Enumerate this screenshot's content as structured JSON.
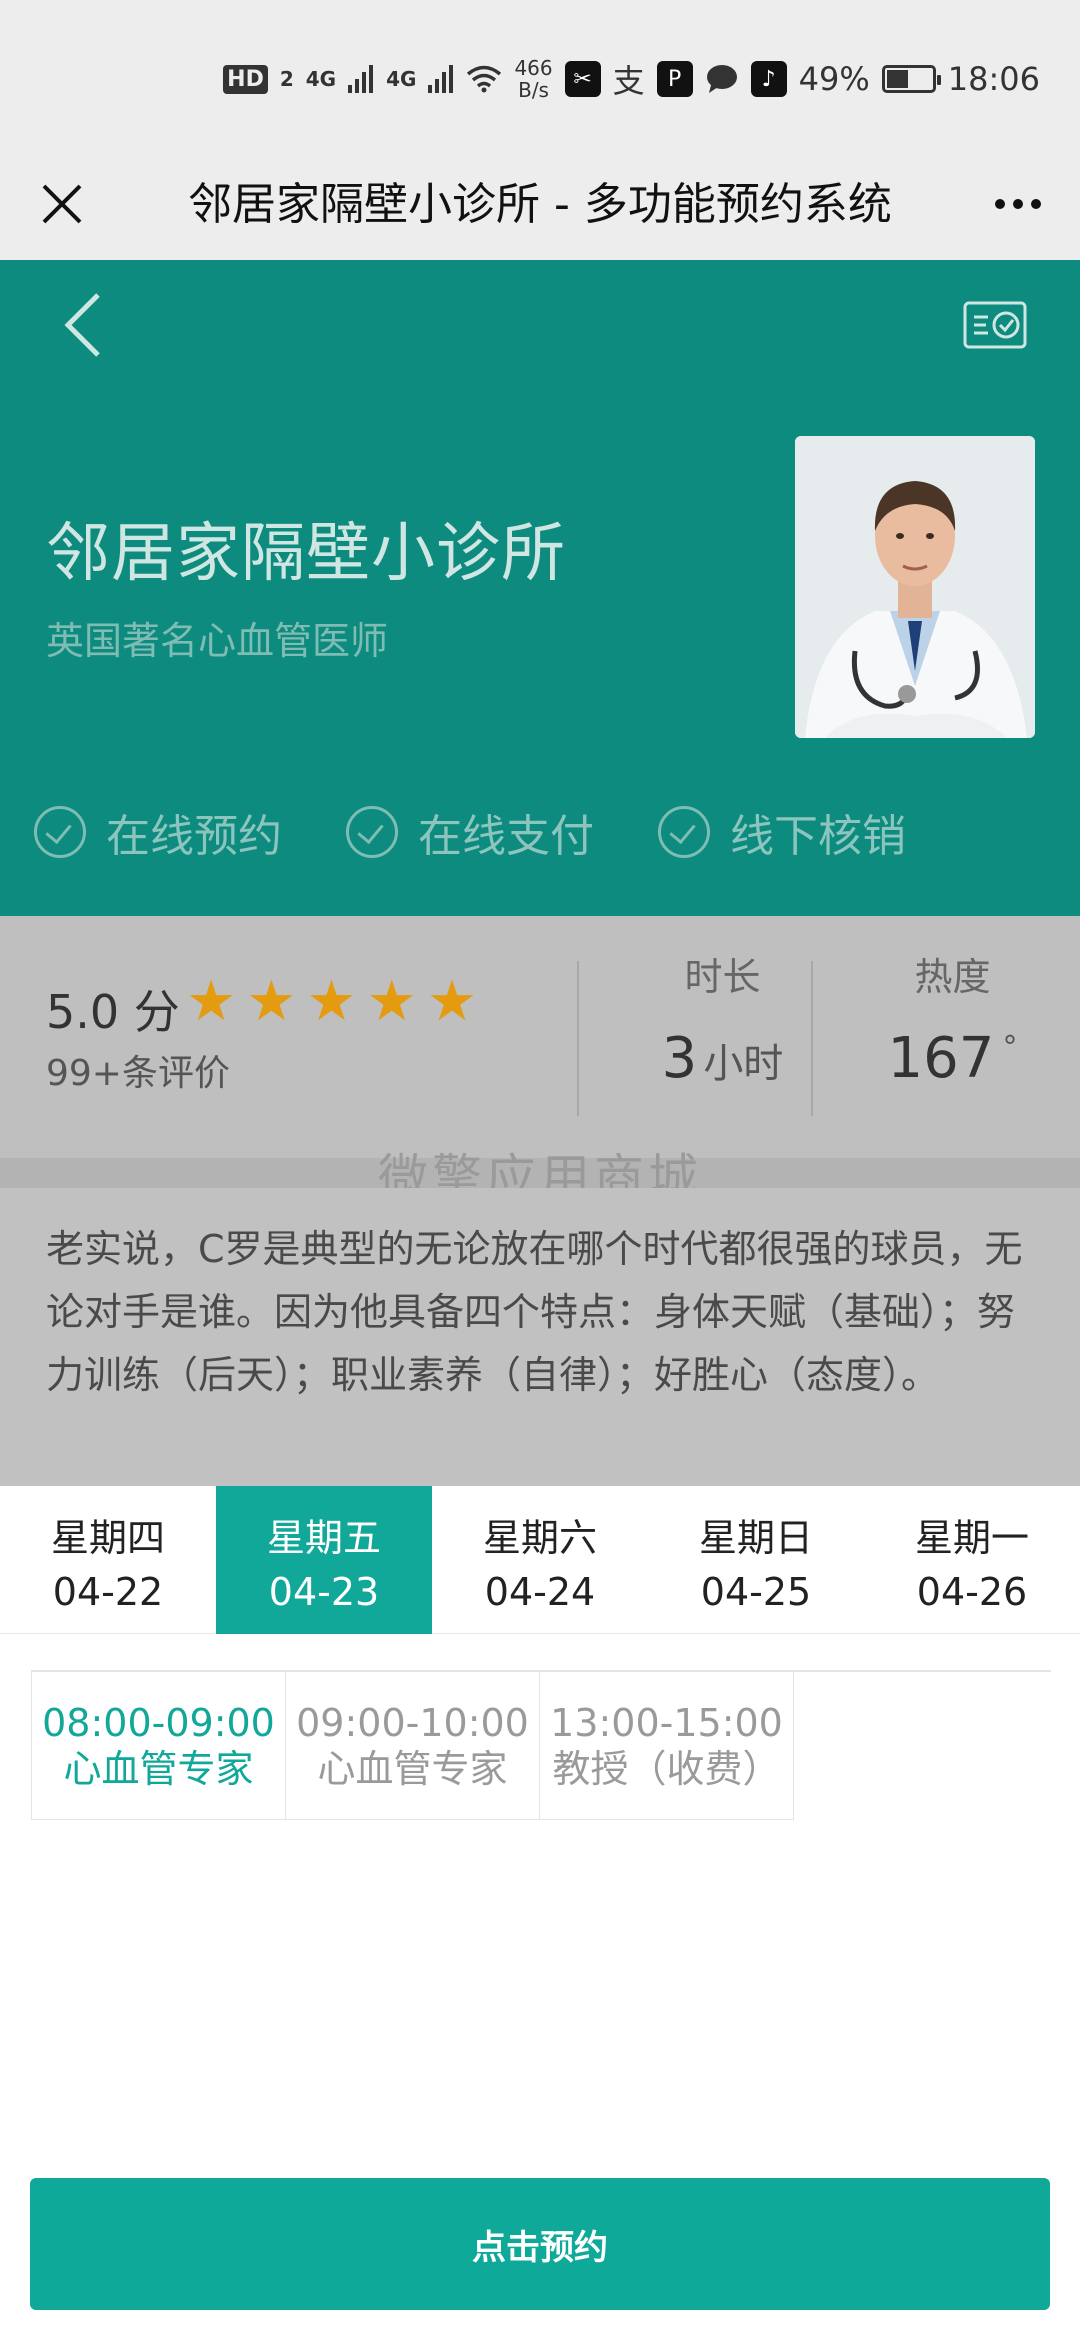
{
  "status_bar": {
    "hd_badge": "HD",
    "sim": "2",
    "signal1": "4G",
    "signal2": "4G",
    "speed_value": "466",
    "speed_unit": "B/s",
    "battery": "49%",
    "battery_level": 0.49,
    "time": "18:06"
  },
  "titlebar": {
    "title": "邻居家隔壁小诊所 - 多功能预约系统"
  },
  "header": {
    "clinic_name": "邻居家隔壁小诊所",
    "subtitle": "英国著名心血管医师",
    "features": [
      "在线预约",
      "在线支付",
      "线下核销"
    ],
    "accent_color": "#0e8b7f"
  },
  "stats": {
    "rating_score": "5.0 分",
    "rating_stars": 5,
    "rating_count": "99+条评价",
    "duration_label": "时长",
    "duration_value": "3",
    "duration_unit": "小时",
    "heat_label": "热度",
    "heat_value": "167",
    "heat_unit": "°"
  },
  "watermark": "微擎应用商城",
  "description": "老实说，C罗是典型的无论放在哪个时代都很强的球员，无论对手是谁。因为他具备四个特点：身体天赋（基础）；努力训练（后天）；职业素养（自律）；好胜心（态度）。",
  "dates": [
    {
      "day": "星期四",
      "date": "04-22"
    },
    {
      "day": "星期五",
      "date": "04-23",
      "active": true
    },
    {
      "day": "星期六",
      "date": "04-24"
    },
    {
      "day": "星期日",
      "date": "04-25"
    },
    {
      "day": "星期一",
      "date": "04-26"
    }
  ],
  "slots": [
    {
      "time": "08:00-09:00",
      "label": "心血管专家",
      "active": true
    },
    {
      "time": "09:00-10:00",
      "label": "心血管专家"
    },
    {
      "time": "13:00-15:00",
      "label": "教授（收费）"
    }
  ],
  "book_button": "点击预约",
  "icons": {
    "close": "close-icon",
    "more": "more-icon",
    "back": "back-icon",
    "ticket": "ticket-check-icon",
    "check": "check-circle-icon",
    "star": "star-icon"
  }
}
